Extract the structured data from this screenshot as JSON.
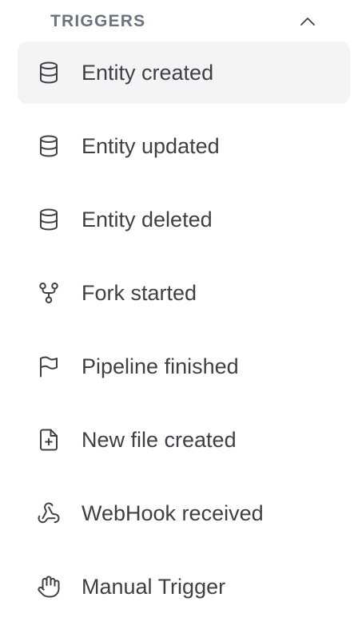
{
  "section": {
    "title": "TRIGGERS",
    "collapse_icon": "chevron-up-icon"
  },
  "triggers": [
    {
      "label": "Entity created",
      "icon": "database-icon",
      "active": true
    },
    {
      "label": "Entity updated",
      "icon": "database-icon",
      "active": false
    },
    {
      "label": "Entity deleted",
      "icon": "database-icon",
      "active": false
    },
    {
      "label": "Fork started",
      "icon": "git-fork-icon",
      "active": false
    },
    {
      "label": "Pipeline finished",
      "icon": "flag-icon",
      "active": false
    },
    {
      "label": "New file created",
      "icon": "file-plus-icon",
      "active": false
    },
    {
      "label": "WebHook received",
      "icon": "webhook-icon",
      "active": false
    },
    {
      "label": "Manual Trigger",
      "icon": "hand-icon",
      "active": false
    }
  ],
  "colors": {
    "active_background": "#f3f4f6",
    "text": "#3f3f46",
    "header_text": "#6b7280"
  }
}
